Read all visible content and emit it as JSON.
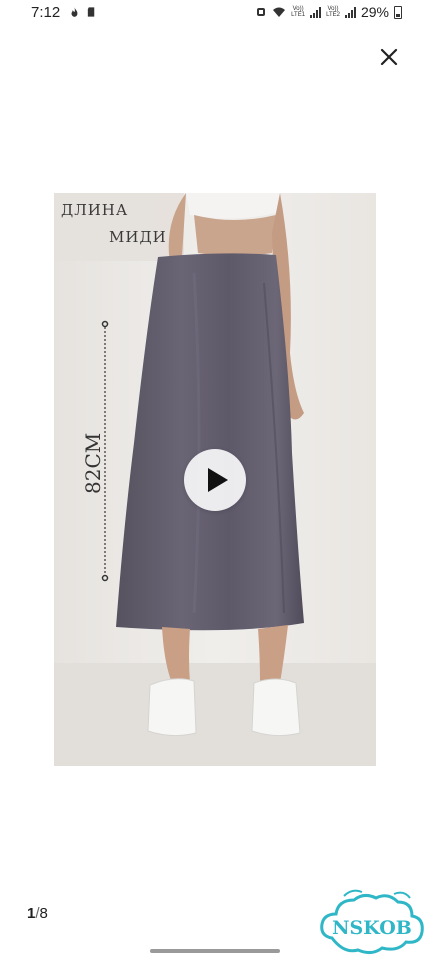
{
  "status_bar": {
    "time": "7:12",
    "network_1": "Vo))\nLTE1",
    "network_2": "Vo))\nLTE2",
    "battery_percent": "29%"
  },
  "icons": {
    "close": "close-icon",
    "play": "play-icon"
  },
  "overlay": {
    "length_line_1": "ДЛИНА",
    "length_line_2": "МИДИ",
    "measure": "82СМ"
  },
  "pagination": {
    "current": "1",
    "separator": "/",
    "total": "8"
  },
  "watermark": {
    "text": "NSKOB"
  },
  "colors": {
    "skirt": "#625d6e",
    "background": "#ece9e6",
    "watermark": "#2fb7c7"
  }
}
